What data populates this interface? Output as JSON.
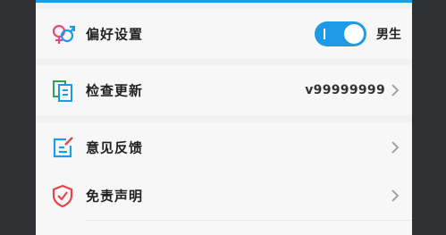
{
  "settings": {
    "preference": {
      "label": "偏好设置",
      "toggle_on": true,
      "value": "男生",
      "icon": "gender-icon"
    },
    "update": {
      "label": "检查更新",
      "value": "v99999999",
      "icon": "document-copy-icon"
    },
    "feedback": {
      "label": "意见反馈",
      "icon": "edit-note-icon"
    },
    "disclaimer": {
      "label": "免责声明",
      "icon": "shield-check-icon"
    }
  },
  "colors": {
    "accent": "#1e9be6",
    "pink": "#e5497b",
    "green": "#2aa35a",
    "red": "#e4454a"
  }
}
